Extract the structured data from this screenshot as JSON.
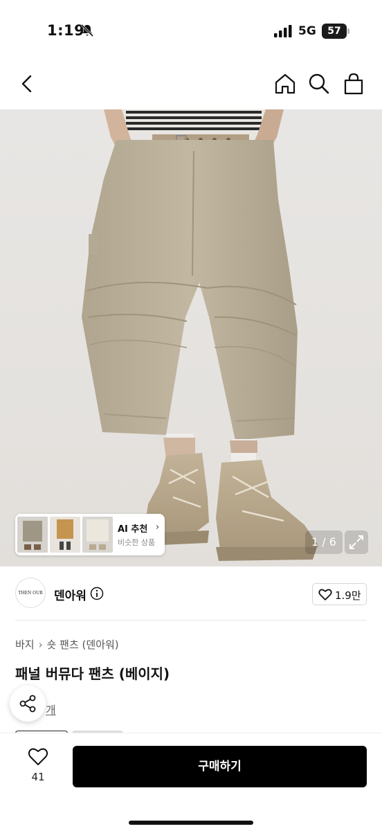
{
  "status_bar": {
    "time": "1:19",
    "network": "5G",
    "battery": "57"
  },
  "nav": {
    "back_icon": "chevron-left-icon",
    "home_icon": "home-icon",
    "search_icon": "search-icon",
    "cart_icon": "shopping-bag-icon"
  },
  "gallery": {
    "counter": "1 / 6",
    "ai_card": {
      "title": "AI 추천",
      "subtitle": "비슷한 상품"
    }
  },
  "brand": {
    "logo_text": "THEN OUR",
    "name": "덴아워",
    "like_count": "1.9만"
  },
  "product": {
    "breadcrumb": [
      "바지",
      "숏 팬츠 (덴아워)"
    ],
    "title": "패널 버뮤다 팬츠 (베이지)",
    "review_fragment": "개"
  },
  "bottom_bar": {
    "wish_count": "41",
    "buy_label": "구매하기"
  },
  "colors": {
    "buy_button": "#000000",
    "pants_beige": "#bdb29b",
    "boot_tan": "#b8a78c",
    "background": "#ffffff"
  }
}
